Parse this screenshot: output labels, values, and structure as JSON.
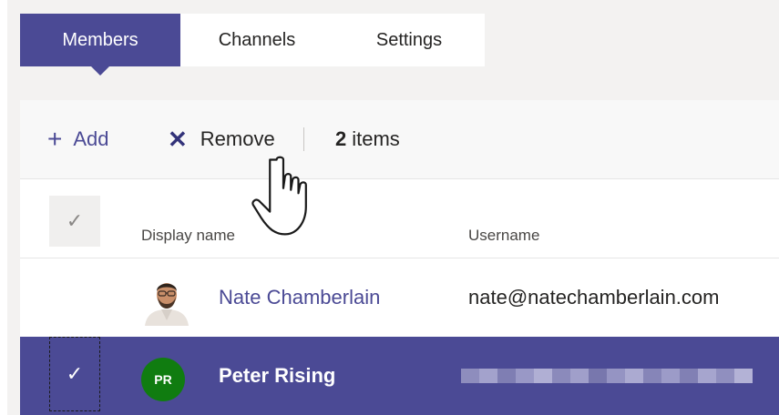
{
  "tabs": [
    {
      "label": "Members",
      "active": true
    },
    {
      "label": "Channels",
      "active": false
    },
    {
      "label": "Settings",
      "active": false
    }
  ],
  "toolbar": {
    "add_label": "Add",
    "remove_label": "Remove",
    "count_number": "2",
    "count_label": "items"
  },
  "table": {
    "headers": {
      "display_name": "Display name",
      "username": "Username"
    },
    "rows": [
      {
        "name": "Nate Chamberlain",
        "username": "nate@natechamberlain.com",
        "avatar": "photo",
        "selected": false
      },
      {
        "name": "Peter Rising",
        "initials": "PR",
        "username_redacted": true,
        "selected": true
      }
    ]
  },
  "icons": {
    "add": "plus-icon",
    "remove": "close-icon",
    "check": "check-icon",
    "cursor": "hand-pointer-icon"
  },
  "colors": {
    "accent": "#4b4a95",
    "avatar_pr": "#107c10",
    "background": "#f3f2f1"
  }
}
